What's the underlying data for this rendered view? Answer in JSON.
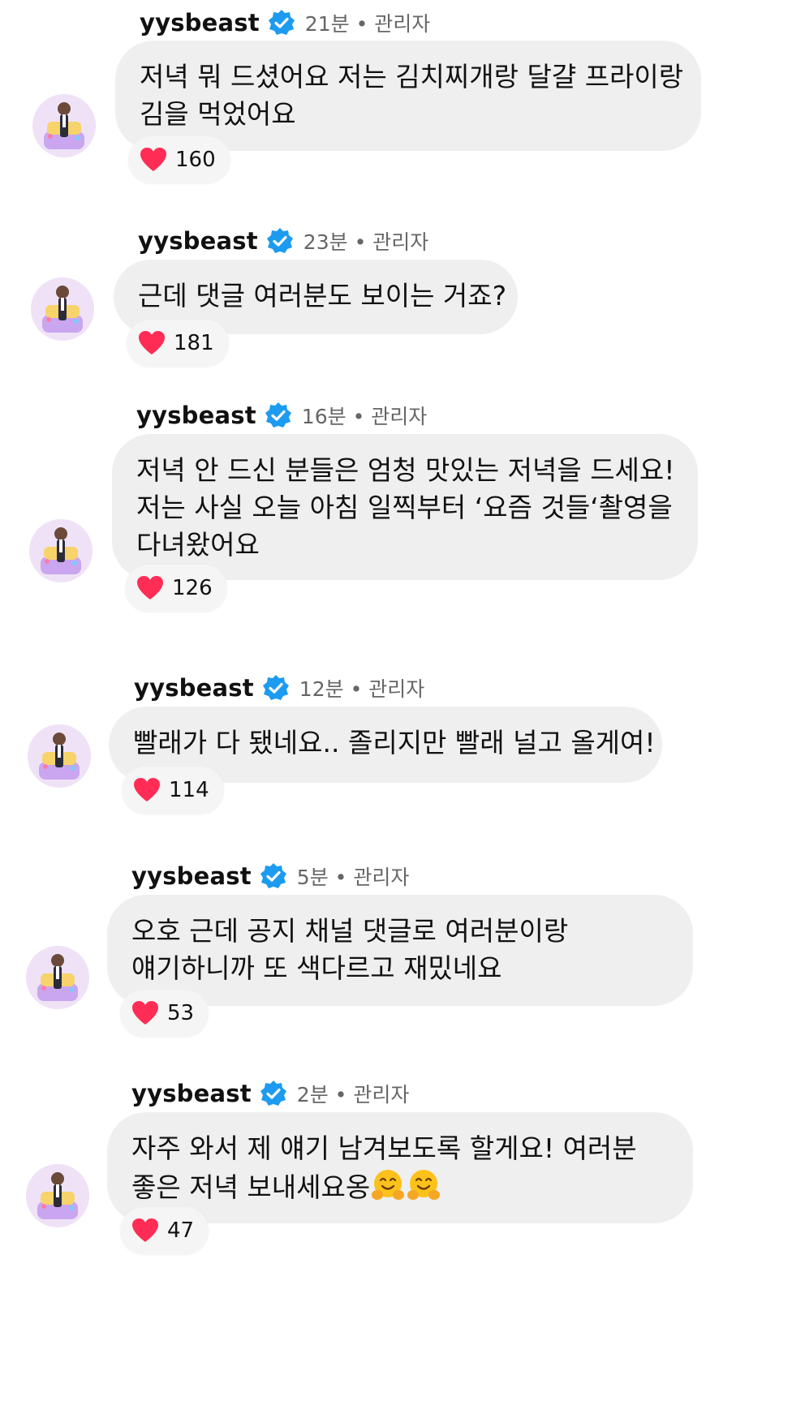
{
  "colors": {
    "bubble": "#efefef",
    "verified": "#1d9bf0",
    "heart": "#ff2d55",
    "meta": "#666666"
  },
  "comments": [
    {
      "username": "yysbeast",
      "time": "21분",
      "separator": "•",
      "role": "관리자",
      "lines": [
        "저녁 뭐 드셨어요 저는 김치찌개랑 달걀 프라이랑",
        "김을 먹었어요"
      ],
      "likes": "160"
    },
    {
      "username": "yysbeast",
      "time": "23분",
      "separator": "•",
      "role": "관리자",
      "lines": [
        "근데 댓글 여러분도 보이는 거죠?"
      ],
      "likes": "181"
    },
    {
      "username": "yysbeast",
      "time": "16분",
      "separator": "•",
      "role": "관리자",
      "lines": [
        "저녁 안 드신 분들은 엄청 맛있는 저녁을 드세요!",
        "저는 사실 오늘 아침 일찍부터 ‘요즘 것들‘촬영을",
        "다녀왔어요"
      ],
      "likes": "126"
    },
    {
      "username": "yysbeast",
      "time": "12분",
      "separator": "•",
      "role": "관리자",
      "lines": [
        "빨래가 다 됐네요.. 졸리지만 빨래 널고 올게여!"
      ],
      "likes": "114"
    },
    {
      "username": "yysbeast",
      "time": "5분",
      "separator": "•",
      "role": "관리자",
      "lines": [
        "오호 근데 공지 채널 댓글로 여러분이랑",
        "얘기하니까 또 색다르고 재밌네요"
      ],
      "likes": "53"
    },
    {
      "username": "yysbeast",
      "time": "2분",
      "separator": "•",
      "role": "관리자",
      "lines": [
        "자주 와서 제 얘기 남겨보도록 할게요! 여러분",
        "좋은 저녁 보내세요옹"
      ],
      "emoji": [
        "hugging-face-emoji",
        "hugging-face-emoji"
      ],
      "likes": "47"
    }
  ]
}
